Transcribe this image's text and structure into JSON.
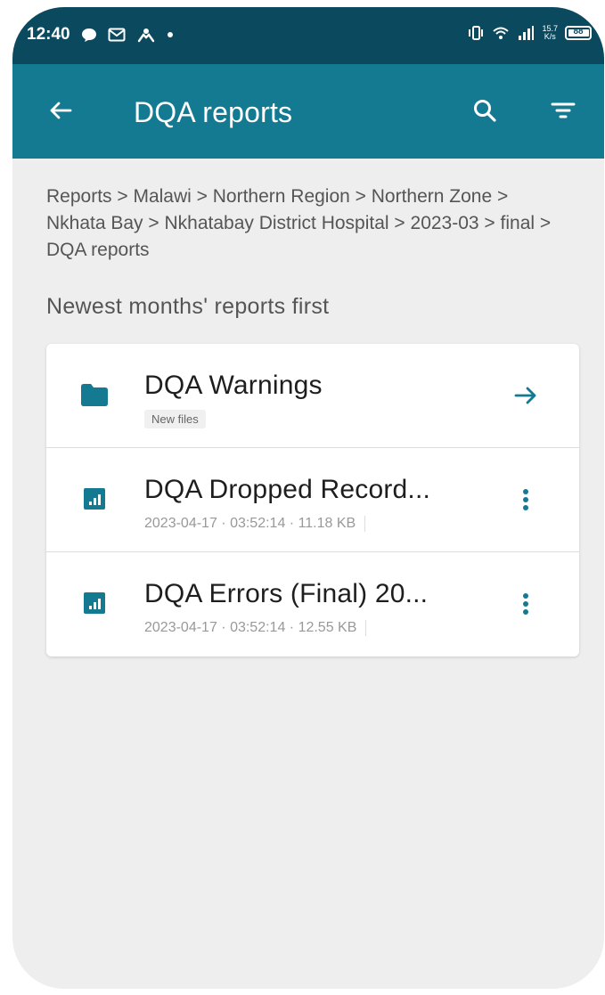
{
  "status_bar": {
    "time": "12:40",
    "left_icons": [
      "chat-bubble-icon",
      "gmail-icon",
      "transfer-icon",
      "notification-dot-icon"
    ],
    "right_icons": [
      "vibrate-icon",
      "wifi-icon",
      "signal-icon",
      "network-speed-icon",
      "battery-icon"
    ],
    "network_speed_line1": "15.7",
    "network_speed_line2": "K/s",
    "battery_text": "88"
  },
  "app_bar": {
    "title": "DQA reports",
    "back_icon": "arrow-back-icon",
    "search_icon": "search-icon",
    "filter_icon": "filter-icon",
    "color": "#137a92",
    "status_color": "#0b4a5e"
  },
  "breadcrumb": "Reports > Malawi > Northern Region > Northern Zone > Nkhata Bay > Nkhatabay District Hospital > 2023-03 > final > DQA reports",
  "section_title": "Newest months' reports first",
  "items": [
    {
      "type": "folder",
      "icon": "folder-icon",
      "name": "DQA Warnings",
      "badge": "New files",
      "action_icon": "arrow-forward-icon"
    },
    {
      "type": "file",
      "icon": "report-chart-icon",
      "name": "DQA Dropped Record...",
      "meta": "2023-04-17 · 03:52:14 · 11.18 KB",
      "action_icon": "more-vert-icon"
    },
    {
      "type": "file",
      "icon": "report-chart-icon",
      "name": "DQA Errors (Final) 20...",
      "meta": "2023-04-17 · 03:52:14 · 12.55 KB",
      "action_icon": "more-vert-icon"
    }
  ]
}
